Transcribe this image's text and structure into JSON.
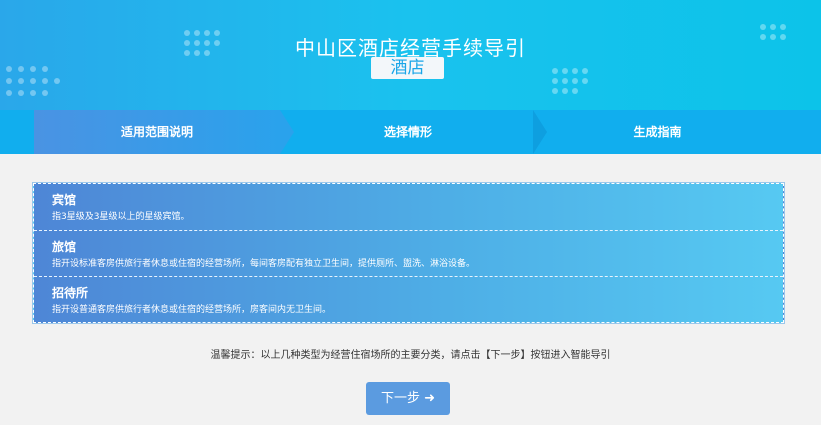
{
  "header": {
    "title": "中山区酒店经营手续导引",
    "subtitle": "酒店"
  },
  "steps": [
    {
      "label": "适用范围说明",
      "active": true
    },
    {
      "label": "选择情形",
      "active": false
    },
    {
      "label": "生成指南",
      "active": false
    }
  ],
  "items": [
    {
      "title": "宾馆",
      "desc": "指3星级及3星级以上的星级宾馆。"
    },
    {
      "title": "旅馆",
      "desc": "指开设标准客房供旅行者休息或住宿的经营场所，每间客房配有独立卫生间，提供厕所、盥洗、淋浴设备。"
    },
    {
      "title": "招待所",
      "desc": "指开设普通客房供旅行者休息或住宿的经营场所，房客间内无卫生间。"
    }
  ],
  "tip": "温馨提示：以上几种类型为经营住宿场所的主要分类，请点击【下一步】按钮进入智能导引",
  "next_button": {
    "label": "下一步",
    "icon": "arrow-right-icon"
  }
}
